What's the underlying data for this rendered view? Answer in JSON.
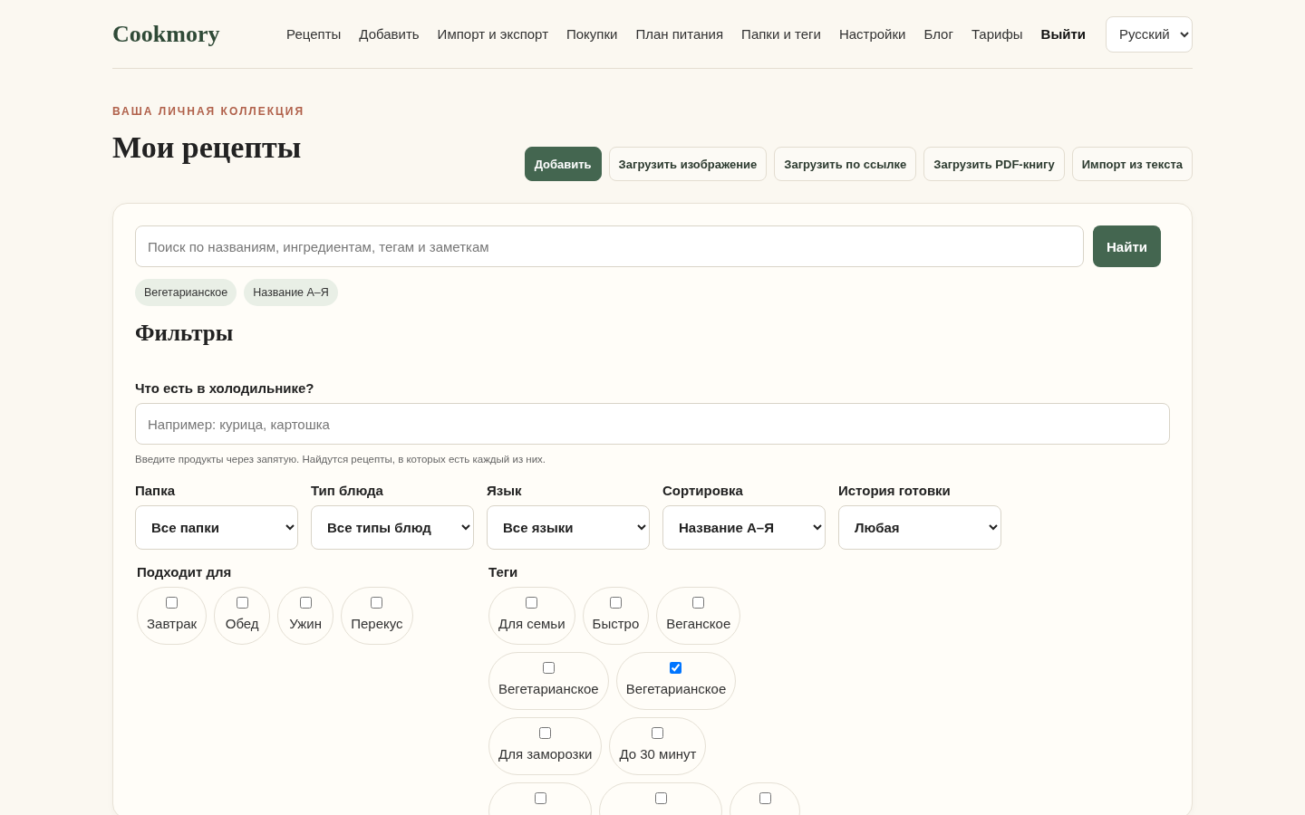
{
  "header": {
    "logo": "Cookmory",
    "nav": [
      {
        "label": "Рецепты",
        "kind": "link"
      },
      {
        "label": "Добавить",
        "kind": "link"
      },
      {
        "label": "Импорт и экспорт",
        "kind": "link"
      },
      {
        "label": "Покупки",
        "kind": "link"
      },
      {
        "label": "План питания",
        "kind": "link"
      },
      {
        "label": "Папки и теги",
        "kind": "link"
      },
      {
        "label": "Настройки",
        "kind": "link"
      },
      {
        "label": "Блог",
        "kind": "link"
      },
      {
        "label": "Тарифы",
        "kind": "link"
      },
      {
        "label": "Выйти",
        "kind": "strong"
      }
    ],
    "language": "Русский"
  },
  "eyebrow": "ВАША ЛИЧНАЯ КОЛЛЕКЦИЯ",
  "title": "Мои рецепты",
  "actions": [
    {
      "label": "Добавить",
      "kind": "primary"
    },
    {
      "label": "Загрузить изображение",
      "kind": "secondary"
    },
    {
      "label": "Загрузить по ссылке",
      "kind": "secondary"
    },
    {
      "label": "Загрузить PDF-книгу",
      "kind": "secondary"
    },
    {
      "label": "Импорт из текста",
      "kind": "secondary"
    }
  ],
  "search": {
    "placeholder": "Поиск по названиям, ингредиентам, тегам и заметкам",
    "button": "Найти"
  },
  "active_filters": [
    "Вегетарианское",
    "Название А–Я"
  ],
  "filters": {
    "heading": "Фильтры",
    "fridge": {
      "label": "Что есть в холодильнике?",
      "placeholder": "Например: курица, картошка",
      "hint": "Введите продукты через запятую. Найдутся рецепты, в которых есть каждый из них."
    },
    "selects": [
      {
        "label": "Папка",
        "value": "Все папки"
      },
      {
        "label": "Тип блюда",
        "value": "Все типы блюд"
      },
      {
        "label": "Язык",
        "value": "Все языки"
      },
      {
        "label": "Сортировка",
        "value": "Название А–Я"
      },
      {
        "label": "История готовки",
        "value": "Любая"
      }
    ],
    "meal": {
      "label": "Подходит для",
      "options": [
        {
          "label": "Завтрак",
          "checked": false
        },
        {
          "label": "Обед",
          "checked": false
        },
        {
          "label": "Ужин",
          "checked": false
        },
        {
          "label": "Перекус",
          "checked": false
        }
      ]
    },
    "tags": {
      "label": "Теги",
      "options": [
        {
          "label": "Для семьи",
          "checked": false
        },
        {
          "label": "Быстро",
          "checked": false
        },
        {
          "label": "Веганское",
          "checked": false
        },
        {
          "label": "Вегетарианское",
          "checked": false
        },
        {
          "label": "Вегетарианское",
          "checked": true
        },
        {
          "label": "Для заморозки",
          "checked": false
        },
        {
          "label": "До 30 минут",
          "checked": false
        },
        {
          "checked": false
        },
        {
          "checked": false
        },
        {
          "checked": false
        }
      ]
    }
  }
}
